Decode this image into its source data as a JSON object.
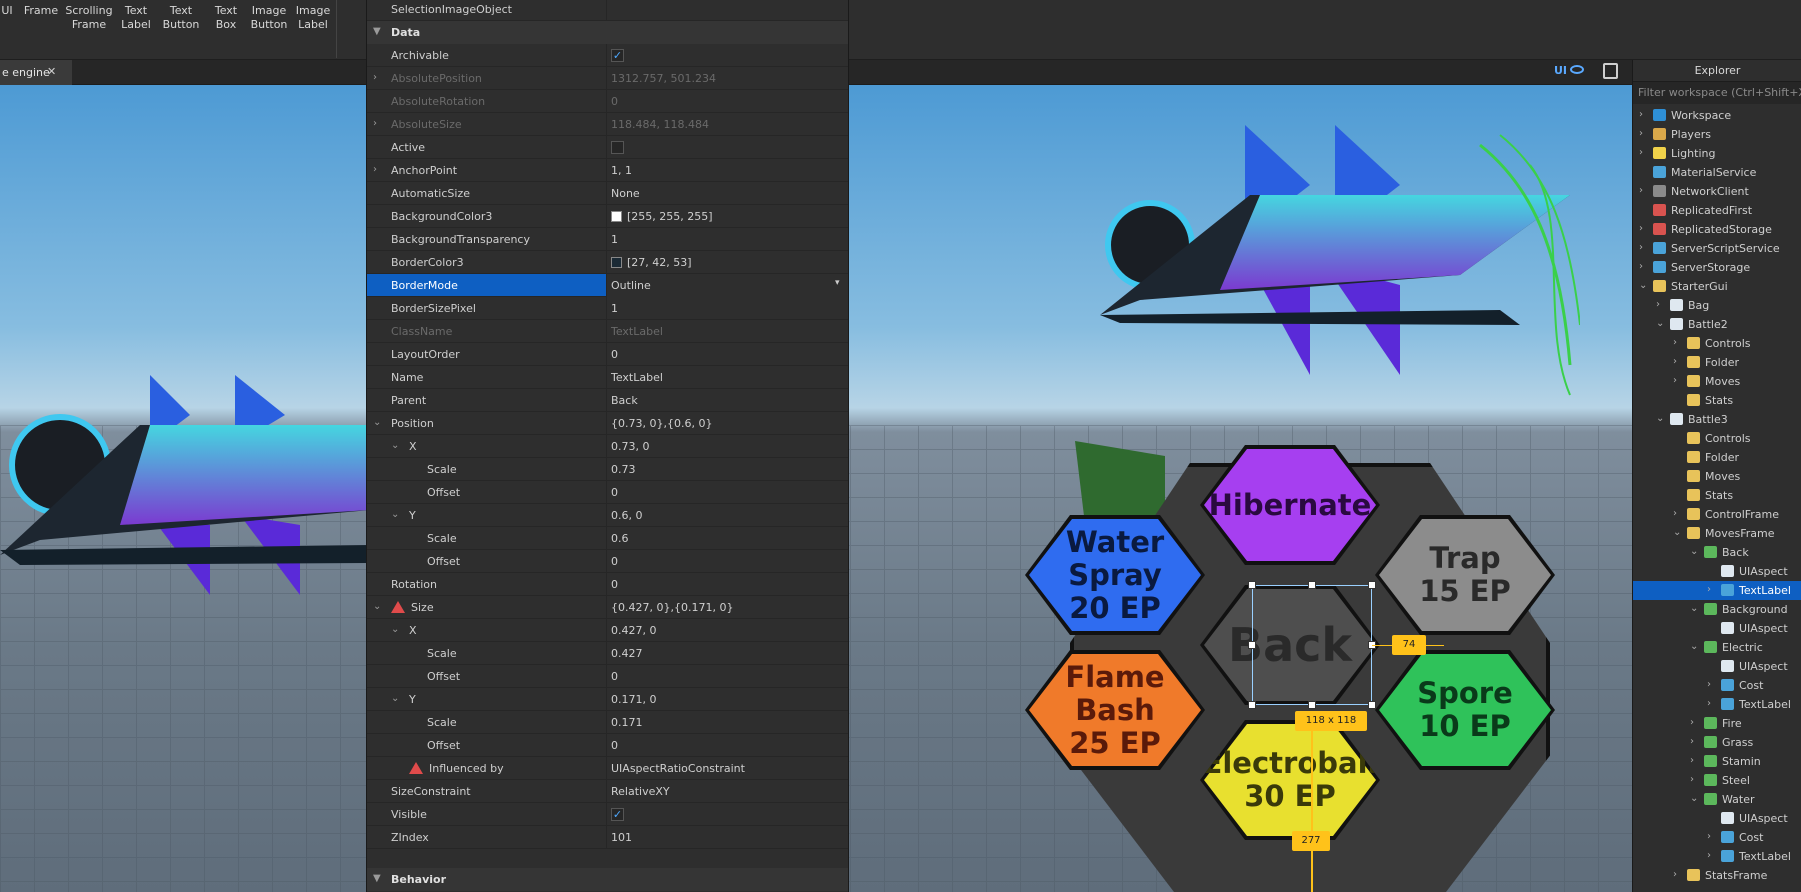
{
  "ribbon": {
    "items": [
      "UI",
      "Frame",
      "Scrolling\nFrame",
      "Text\nLabel",
      "Text\nButton",
      "Text\nBox",
      "Image\nButton",
      "Image\nLabel"
    ]
  },
  "tabs": {
    "doc_tab": "e engine",
    "close_glyph": "✕",
    "ui_label": "UI"
  },
  "properties": {
    "top_row": "SelectionImageObject",
    "section_data": "Data",
    "section_behavior": "Behavior",
    "rows": [
      {
        "name": "Archivable",
        "value": "",
        "check": true
      },
      {
        "name": "AbsolutePosition",
        "value": "1312.757, 501.234",
        "disabled": true
      },
      {
        "name": "AbsoluteRotation",
        "value": "0",
        "disabled": true
      },
      {
        "name": "AbsoluteSize",
        "value": "118.484, 118.484",
        "disabled": true
      },
      {
        "name": "Active",
        "value": "",
        "check": false
      },
      {
        "name": "AnchorPoint",
        "value": "1, 1"
      },
      {
        "name": "AutomaticSize",
        "value": "None"
      },
      {
        "name": "BackgroundColor3",
        "value": "[255, 255, 255]",
        "swatch": "#ffffff"
      },
      {
        "name": "BackgroundTransparency",
        "value": "1"
      },
      {
        "name": "BorderColor3",
        "value": "[27, 42, 53]",
        "swatch": "#1b2a35"
      },
      {
        "name": "BorderMode",
        "value": "Outline",
        "selected": true
      },
      {
        "name": "BorderSizePixel",
        "value": "1"
      },
      {
        "name": "ClassName",
        "value": "TextLabel",
        "disabled": true
      },
      {
        "name": "LayoutOrder",
        "value": "0"
      },
      {
        "name": "Name",
        "value": "TextLabel"
      },
      {
        "name": "Parent",
        "value": "Back"
      },
      {
        "name": "Position",
        "value": "{0.73, 0},{0.6, 0}"
      },
      {
        "name": "X",
        "value": "0.73, 0"
      },
      {
        "name": "Scale",
        "value": "0.73"
      },
      {
        "name": "Offset",
        "value": "0"
      },
      {
        "name": "Y",
        "value": "0.6, 0"
      },
      {
        "name": "Scale",
        "value": "0.6"
      },
      {
        "name": "Offset",
        "value": "0"
      },
      {
        "name": "Rotation",
        "value": "0"
      },
      {
        "name": "Size",
        "value": "{0.427, 0},{0.171, 0}"
      },
      {
        "name": "X",
        "value": "0.427, 0"
      },
      {
        "name": "Scale",
        "value": "0.427"
      },
      {
        "name": "Offset",
        "value": "0"
      },
      {
        "name": "Y",
        "value": "0.171, 0"
      },
      {
        "name": "Scale",
        "value": "0.171"
      },
      {
        "name": "Offset",
        "value": "0"
      },
      {
        "name": "Influenced by",
        "value": "UIAspectRatioConstraint"
      },
      {
        "name": "SizeConstraint",
        "value": "RelativeXY"
      },
      {
        "name": "Visible",
        "value": "",
        "check": true
      },
      {
        "name": "ZIndex",
        "value": "101"
      }
    ]
  },
  "explorer": {
    "title": "Explorer",
    "filter_placeholder": "Filter workspace (Ctrl+Shift+X)",
    "items": [
      {
        "label": "Workspace",
        "icon": "#2e8fd6"
      },
      {
        "label": "Players",
        "icon": "#d9a84a"
      },
      {
        "label": "Lighting",
        "icon": "#f0d24a"
      },
      {
        "label": "MaterialService",
        "icon": "#4aa3d9"
      },
      {
        "label": "NetworkClient",
        "icon": "#8a8a8a"
      },
      {
        "label": "ReplicatedFirst",
        "icon": "#d9534f"
      },
      {
        "label": "ReplicatedStorage",
        "icon": "#d9534f"
      },
      {
        "label": "ServerScriptService",
        "icon": "#4aa3d9"
      },
      {
        "label": "ServerStorage",
        "icon": "#4aa3d9"
      },
      {
        "label": "StarterGui",
        "icon": "#e8c35a"
      },
      {
        "label": "Bag",
        "icon": "#dfe8f0"
      },
      {
        "label": "Battle2",
        "icon": "#dfe8f0"
      },
      {
        "label": "Controls",
        "icon": "#e8c35a"
      },
      {
        "label": "Folder",
        "icon": "#e8c35a"
      },
      {
        "label": "Moves",
        "icon": "#e8c35a"
      },
      {
        "label": "Stats",
        "icon": "#e8c35a"
      },
      {
        "label": "Battle3",
        "icon": "#dfe8f0"
      },
      {
        "label": "Controls",
        "icon": "#e8c35a"
      },
      {
        "label": "Folder",
        "icon": "#e8c35a"
      },
      {
        "label": "Moves",
        "icon": "#e8c35a"
      },
      {
        "label": "Stats",
        "icon": "#e8c35a"
      },
      {
        "label": "ControlFrame",
        "icon": "#e8c35a"
      },
      {
        "label": "MovesFrame",
        "icon": "#e8c35a"
      },
      {
        "label": "Back",
        "icon": "#5cb85c"
      },
      {
        "label": "UIAspect",
        "icon": "#dfe8f0"
      },
      {
        "label": "TextLabel",
        "icon": "#4aa3d9"
      },
      {
        "label": "Background",
        "icon": "#5cb85c"
      },
      {
        "label": "UIAspect",
        "icon": "#dfe8f0"
      },
      {
        "label": "Electric",
        "icon": "#5cb85c"
      },
      {
        "label": "UIAspect",
        "icon": "#dfe8f0"
      },
      {
        "label": "Cost",
        "icon": "#4aa3d9"
      },
      {
        "label": "TextLabel",
        "icon": "#4aa3d9"
      },
      {
        "label": "Fire",
        "icon": "#5cb85c"
      },
      {
        "label": "Grass",
        "icon": "#5cb85c"
      },
      {
        "label": "Stamin",
        "icon": "#5cb85c"
      },
      {
        "label": "Steel",
        "icon": "#5cb85c"
      },
      {
        "label": "Water",
        "icon": "#5cb85c"
      },
      {
        "label": "UIAspect",
        "icon": "#dfe8f0"
      },
      {
        "label": "Cost",
        "icon": "#4aa3d9"
      },
      {
        "label": "TextLabel",
        "icon": "#4aa3d9"
      },
      {
        "label": "StatsFrame",
        "icon": "#e8c35a"
      }
    ]
  },
  "moves": {
    "hibernate": "Hibernate",
    "water_name": "Water Spray",
    "water_cost": "20 EP",
    "trap_name": "Trap",
    "trap_cost": "15 EP",
    "back": "Back",
    "fire_name": "Flame Bash",
    "fire_cost": "25 EP",
    "spore_name": "Spore",
    "spore_cost": "10 EP",
    "electro_name": "Electroball",
    "electro_cost": "30 EP"
  },
  "measure": {
    "offset_label": "74",
    "size_label": "118 x 118",
    "bottom_label": "277"
  }
}
